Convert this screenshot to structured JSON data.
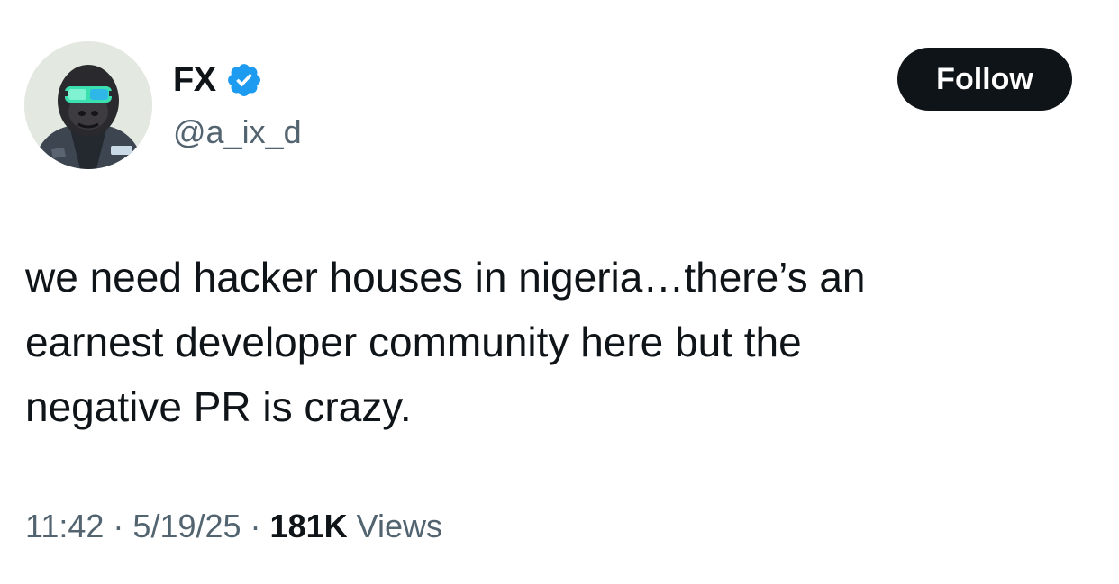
{
  "author": {
    "display_name": "FX",
    "handle": "@a_ix_d",
    "verified_icon": "verified-badge-icon",
    "avatar_icon": "gorilla-avatar-icon"
  },
  "follow_button": {
    "label": "Follow"
  },
  "tweet": {
    "lines": [
      "we need hacker houses in nigeria…there’s an",
      "earnest developer community here but the",
      "negative PR is crazy."
    ]
  },
  "meta": {
    "time": "11:42",
    "separator": "·",
    "date": "5/19/25",
    "views_count": "181K",
    "views_label": "Views"
  },
  "colors": {
    "text_primary": "#0f1419",
    "text_secondary": "#536471",
    "verified_blue": "#1d9bf0",
    "button_bg": "#0f1419",
    "button_text": "#ffffff"
  }
}
